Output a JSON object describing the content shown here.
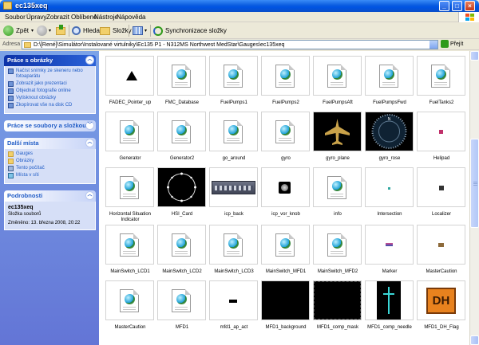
{
  "window": {
    "title": "ec135xeq"
  },
  "menu": [
    "Soubor",
    "Úpravy",
    "Zobrazit",
    "Oblíbené",
    "Nástroje",
    "Nápověda"
  ],
  "toolbar": {
    "back": "Zpět",
    "search": "Hledat",
    "folders": "Složky",
    "sync": "Synchronizace složky"
  },
  "address": {
    "label": "Adresa",
    "path": "D:\\[René]\\Simulátor\\Instalované virtulniky\\Ec135 P1 - N312MS Northwest MedStar\\Gauges\\ec135xeq",
    "go": "Přejít"
  },
  "taskpane": {
    "tasks": {
      "title": "Práce s obrázky",
      "items": [
        "Načíst snímky ze skeneru nebo fotoaparátu",
        "Zobrazit jako prezentaci",
        "Objednat fotografie online",
        "Vytisknout obrázky",
        "Zkopírovat vše na disk CD"
      ]
    },
    "files": {
      "title": "Práce se soubory a složkou"
    },
    "places": {
      "title": "Další místa",
      "items": [
        "Gauges",
        "Obrázky",
        "Tento počítač",
        "Místa v síti"
      ]
    },
    "details": {
      "title": "Podrobnosti",
      "name": "ec135xeq",
      "type": "Složka souborů",
      "modified": "Změněno: 13. března 2008, 20:22"
    }
  },
  "files": [
    {
      "name": "FADEC_Pointer_up",
      "kind": "pointer"
    },
    {
      "name": "FMC_Database",
      "kind": "file"
    },
    {
      "name": "FuelPumps1",
      "kind": "file"
    },
    {
      "name": "FuelPumps2",
      "kind": "file"
    },
    {
      "name": "FuelPumpsAft",
      "kind": "file"
    },
    {
      "name": "FuelPumpsFwd",
      "kind": "file"
    },
    {
      "name": "FuelTanks2",
      "kind": "file"
    },
    {
      "name": "Generator",
      "kind": "file"
    },
    {
      "name": "Generator2",
      "kind": "file"
    },
    {
      "name": "go_around",
      "kind": "file"
    },
    {
      "name": "gyro",
      "kind": "file"
    },
    {
      "name": "gyro_plane",
      "kind": "plane"
    },
    {
      "name": "gyro_rose",
      "kind": "rose"
    },
    {
      "name": "Helipad",
      "kind": "dot"
    },
    {
      "name": "Horizontal Situation Indicator",
      "kind": "file"
    },
    {
      "name": "HSI_Card",
      "kind": "hsi"
    },
    {
      "name": "icp_back",
      "kind": "icp"
    },
    {
      "name": "icp_vor_knob",
      "kind": "knob"
    },
    {
      "name": "info",
      "kind": "file"
    },
    {
      "name": "Intersection",
      "kind": "tiny"
    },
    {
      "name": "Localizer",
      "kind": "plus"
    },
    {
      "name": "MainSwitch_LCD1",
      "kind": "file"
    },
    {
      "name": "MainSwitch_LCD2",
      "kind": "file"
    },
    {
      "name": "MainSwitch_LCD3",
      "kind": "file"
    },
    {
      "name": "MainSwitch_MFD1",
      "kind": "file"
    },
    {
      "name": "MainSwitch_MFD2",
      "kind": "file"
    },
    {
      "name": "Marker",
      "kind": "marker"
    },
    {
      "name": "MasterCaution",
      "kind": "mini"
    },
    {
      "name": "MasterCaution",
      "kind": "file"
    },
    {
      "name": "MFD1",
      "kind": "file"
    },
    {
      "name": "mfd1_ap_act",
      "kind": "dash"
    },
    {
      "name": "MFD1_background",
      "kind": "black"
    },
    {
      "name": "MFD1_comp_mask",
      "kind": "mask"
    },
    {
      "name": "MFD1_comp_needle",
      "kind": "needle"
    },
    {
      "name": "MFD1_DH_Flag",
      "kind": "dh",
      "text": "DH"
    }
  ],
  "colors": {
    "xp_blue": "#0054e3",
    "taskpane": "#6375d6",
    "dh_orange": "#e8821e"
  }
}
